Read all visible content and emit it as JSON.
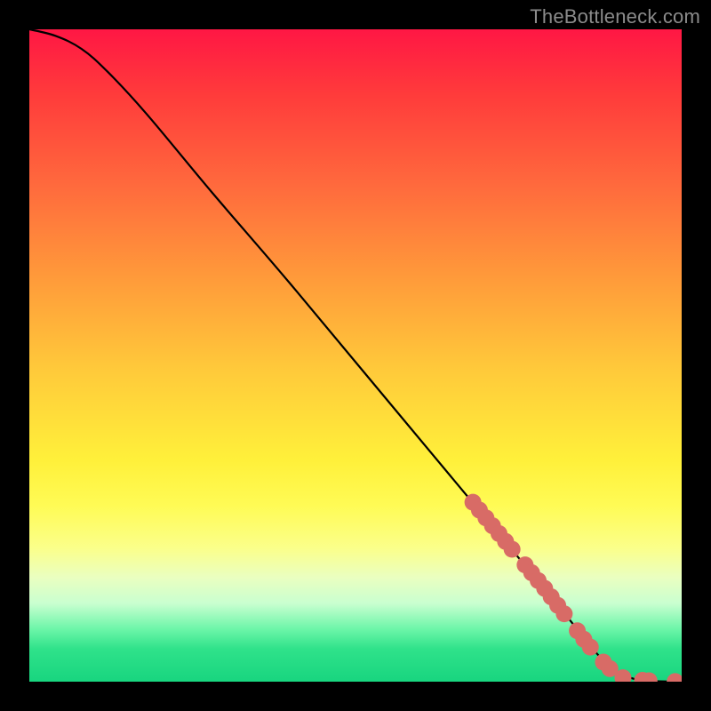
{
  "watermark": "TheBottleneck.com",
  "colors": {
    "curve": "#000000",
    "marker_fill": "#d86b66",
    "marker_stroke": "#c35a55",
    "gradient_top": "#ff1744",
    "gradient_bottom": "#18d57f"
  },
  "chart_data": {
    "type": "line",
    "title": "",
    "xlabel": "",
    "ylabel": "",
    "xlim": [
      0,
      100
    ],
    "ylim": [
      0,
      100
    ],
    "grid": false,
    "legend": false,
    "series": [
      {
        "name": "curve",
        "style": "line",
        "x": [
          0,
          4,
          8,
          12,
          18,
          28,
          40,
          55,
          70,
          80,
          84,
          86,
          88,
          90,
          93,
          95,
          98,
          100
        ],
        "y": [
          100,
          99,
          97,
          93.5,
          87,
          75,
          61,
          43,
          25,
          13,
          8,
          5.5,
          3.2,
          1.4,
          0.35,
          0.1,
          0.02,
          0
        ]
      },
      {
        "name": "markers",
        "style": "scatter",
        "x": [
          68,
          69,
          70,
          71,
          72,
          73,
          74,
          76,
          77,
          78,
          79,
          80,
          81,
          82,
          84,
          85,
          86,
          88,
          89,
          91,
          94,
          95,
          99
        ],
        "y": [
          27.5,
          26.3,
          25.1,
          23.9,
          22.7,
          21.5,
          20.3,
          17.9,
          16.7,
          15.5,
          14.3,
          13.0,
          11.7,
          10.4,
          7.8,
          6.5,
          5.3,
          3.0,
          2.0,
          0.6,
          0.2,
          0.14,
          0.02
        ]
      }
    ]
  }
}
